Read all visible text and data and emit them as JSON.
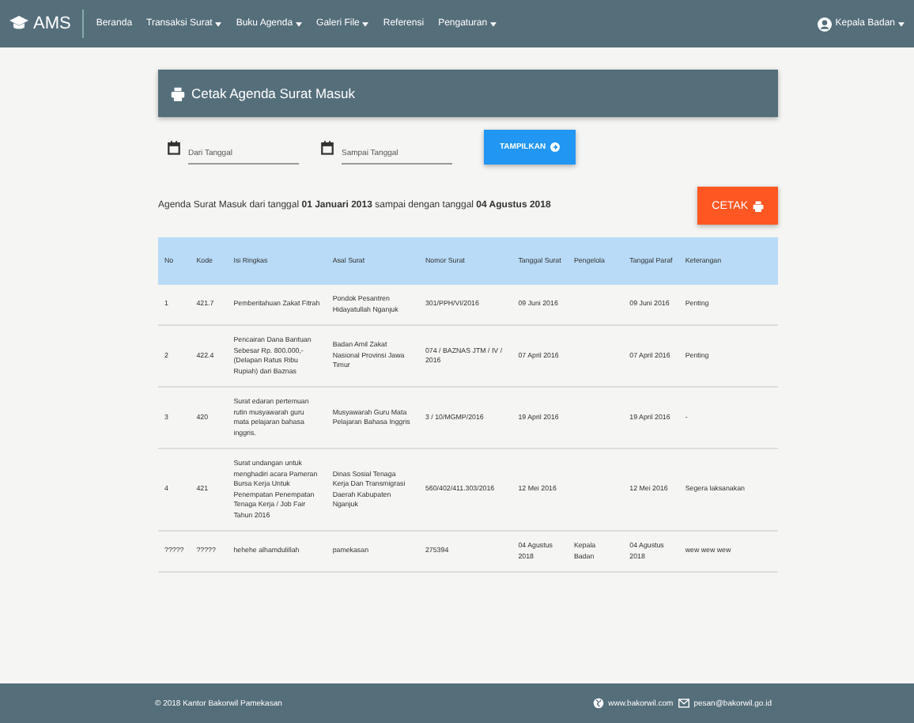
{
  "navbar": {
    "brand": "AMS",
    "menu": [
      {
        "label": "Beranda",
        "has_menu": false
      },
      {
        "label": "Transaksi Surat",
        "has_menu": true
      },
      {
        "label": "Buku Agenda",
        "has_menu": true
      },
      {
        "label": "Galeri File",
        "has_menu": true
      },
      {
        "label": "Referensi",
        "has_menu": false
      },
      {
        "label": "Pengaturan",
        "has_menu": true
      }
    ],
    "user": "Kepala Badan"
  },
  "card": {
    "title": "Cetak Agenda Surat Masuk"
  },
  "filter": {
    "from": {
      "placeholder": "Dari Tanggal"
    },
    "to": {
      "placeholder": "Sampai Tanggal"
    },
    "button": "TAMPILKAN"
  },
  "summary": "Agenda Surat Masuk dari tanggal **01 Januari 2013** sampai dengan tanggal **04 Agustus 2018**",
  "print_button": "CETAK",
  "table": {
    "columns": [
      "No",
      "Kode",
      "Isi Ringkas",
      "Asal Surat",
      "Nomor Surat",
      "Tanggal Surat",
      "Pengelola",
      "Tanggal Paraf",
      "Keterangan"
    ],
    "rows": [
      [
        "1",
        "421.7",
        "Pemberitahuan Zakat Fitrah",
        "Pondok Pesantren Hidayatullah Nganjuk",
        "301/PPH/VI/2016",
        "09 Juni 2016",
        "",
        "09 Juni 2016",
        "Penting"
      ],
      [
        "2",
        "422.4",
        "Pencairan Dana Bantuan Sebesar Rp. 800.000,- (Delapan Ratus Ribu Rupiah) dari Baznas",
        "Badan Amil Zakat Nasional Provinsi Jawa Timur",
        "074 / BAZNAS JTM / IV / 2016",
        "07 April 2016",
        "",
        "07 April 2016",
        "Penting"
      ],
      [
        "3",
        "420",
        "Surat edaran pertemuan rutin musyawarah guru mata pelajaran bahasa inggris.",
        "Musyawarah Guru Mata Pelajaran Bahasa Inggris",
        "3 / 10/MGMP/2016",
        "19 April 2016",
        "",
        "19 April 2016",
        "-"
      ],
      [
        "4",
        "421",
        "Surat undangan untuk menghadiri acara Pameran Bursa Kerja Untuk Penempatan Penempatan Tenaga Kerja / Job Fair Tahun 2016",
        "Dinas Sosial Tenaga Kerja Dan Transmigrasi Daerah Kabupaten Nganjuk",
        "560/402/411.303/2016",
        "12 Mei 2016",
        "",
        "12 Mei 2016",
        "Segera laksanakan"
      ],
      [
        "?????",
        "?????",
        "hehehe alhamdulillah",
        "pamekasan",
        "275394",
        "04 Agustus 2018",
        "Kepala Badan",
        "04 Agustus 2018",
        "wew wew wew"
      ]
    ]
  },
  "footer": {
    "copyright": "© 2018 Kantor Bakorwil Pamekasan",
    "website": "www.bakorwil.com",
    "email": "pesan@bakorwil.go.id"
  }
}
